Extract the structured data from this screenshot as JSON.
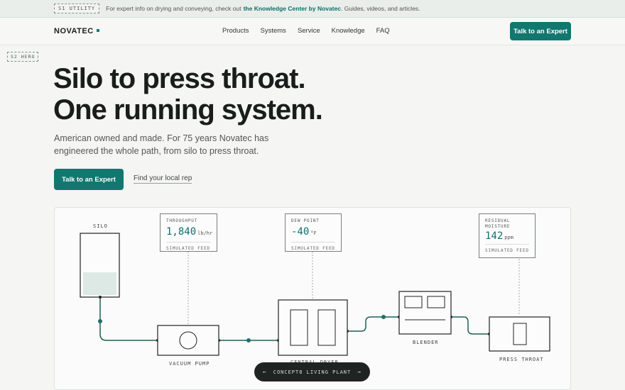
{
  "utility": {
    "tag": "S1 UTILITY",
    "text_before": "For expert info on drying and conveying, check out ",
    "link": "the Knowledge Center by Novatec",
    "text_after": ". Guides, videos, and articles."
  },
  "nav": {
    "logo": "NOVATEC",
    "items": [
      "Products",
      "Systems",
      "Service",
      "Knowledge",
      "FAQ"
    ],
    "cta": "Talk to an Expert"
  },
  "hero": {
    "tag": "S2 HERO",
    "title_line1": "Silo to press throat.",
    "title_line2": "One running system.",
    "subtitle": "American owned and made. For 75 years Novatec has engineered the whole path, from silo to press throat.",
    "cta": "Talk to an Expert",
    "link": "Find your local rep"
  },
  "diagram": {
    "labels": {
      "silo": "SILO",
      "vacuum_pump": "VACUUM PUMP",
      "central_dryer": "CENTRAL DRYER",
      "blender": "BLENDER",
      "press_throat": "PRESS THROAT"
    },
    "readouts": [
      {
        "title": "THROUGHPUT",
        "value": "1,840",
        "unit": "lb/hr",
        "footer": "SIMULATED FEED"
      },
      {
        "title": "DEW POINT",
        "value": "-40",
        "unit": "°F",
        "footer": "SIMULATED FEED"
      },
      {
        "title": "RESIDUAL MOISTURE",
        "value": "142",
        "unit": "ppm",
        "footer": "SIMULATED FEED"
      }
    ],
    "silo_fill": 0.38,
    "accent_color": "#12776f"
  },
  "carousel": {
    "prev_icon": "←",
    "label": "CONCEPT8 LIVING PLANT",
    "next_icon": "→"
  }
}
